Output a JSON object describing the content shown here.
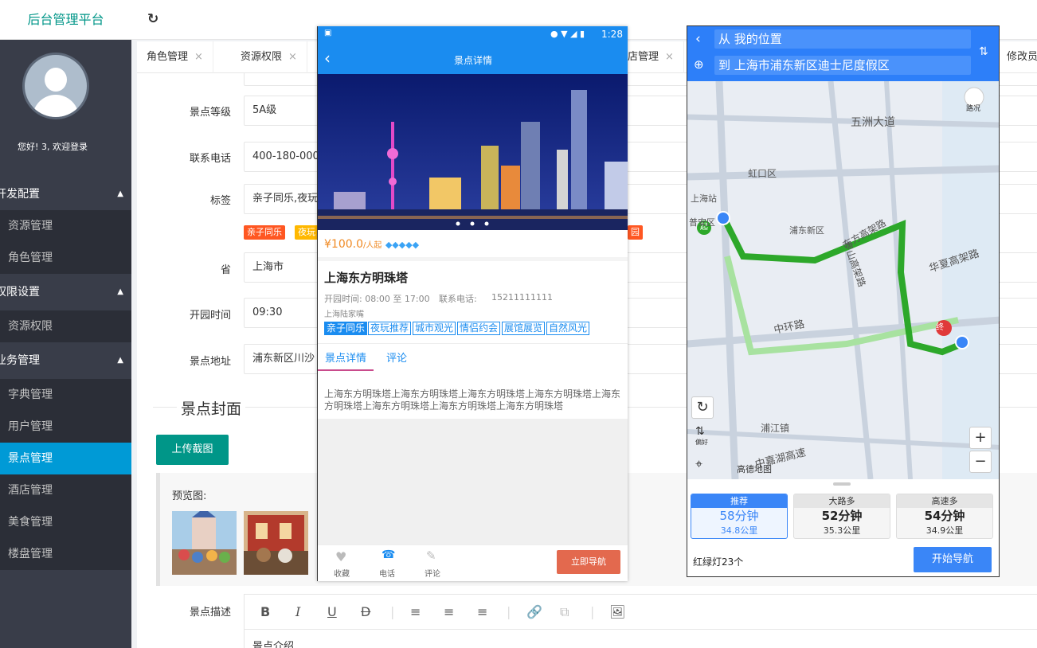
{
  "app": {
    "title": "后台管理平台",
    "refresh_icon": "refresh-icon"
  },
  "sidebar": {
    "welcome": "您好! 3, 欢迎登录",
    "groups": [
      {
        "label": "开发配置",
        "items": [
          "资源管理",
          "角色管理"
        ]
      },
      {
        "label": "权限设置",
        "items": [
          "资源权限"
        ]
      },
      {
        "label": "业务管理",
        "items": [
          "字典管理",
          "用户管理",
          "景点管理",
          "酒店管理",
          "美食管理",
          "楼盘管理"
        ]
      }
    ],
    "active_item": "景点管理",
    "active_color": "#009ad6"
  },
  "tabs": [
    {
      "label": "角色管理",
      "close": "×"
    },
    {
      "label": "资源权限",
      "close": "×"
    },
    {
      "label": "店管理",
      "close": "×"
    },
    {
      "label": "修改员工",
      "close": ""
    }
  ],
  "form": {
    "fields": [
      {
        "label": "景点等级",
        "value": "5A级"
      },
      {
        "label": "联系电话",
        "value": "400-180-000"
      },
      {
        "label": "标签",
        "value": "亲子同乐,夜玩"
      },
      {
        "label": "省",
        "value": "上海市"
      },
      {
        "label": "开园时间",
        "value": "09:30"
      },
      {
        "label": "景点地址",
        "value": "浦东新区川沙"
      }
    ],
    "tag_chips": [
      "亲子同乐",
      "夜玩",
      "园"
    ],
    "cover_legend": "景点封面",
    "upload_label": "上传截图",
    "preview_label": "预览图:",
    "desc_label": "景点描述",
    "desc_text": "景点介绍",
    "editor_tools": [
      "B",
      "I",
      "U",
      "D",
      "align-left-icon",
      "align-center-icon",
      "align-right-icon",
      "link-icon",
      "unlink-icon",
      "image-icon"
    ],
    "brand_color": "#009688"
  },
  "phone": {
    "status_time": "1:28",
    "nav_title": "景点详情",
    "price": "¥100.0",
    "price_unit": "/人起",
    "name": "上海东方明珠塔",
    "hours": "开园时间:  08:00 至 17:00",
    "phone_label": "联系电话:",
    "phone_value": "15211111111",
    "location": "上海陆家嘴",
    "tags": [
      "亲子同乐",
      "夜玩推荐",
      "城市观光",
      "情侣约会",
      "展馆展览",
      "自然风光"
    ],
    "tabs": [
      "景点详情",
      "评论"
    ],
    "description": "上海东方明珠塔上海东方明珠塔上海东方明珠塔上海东方明珠塔上海东方明珠塔上海东方明珠塔上海东方明珠塔上海东方明珠塔",
    "bottom_actions": [
      "收藏",
      "电话",
      "评论"
    ],
    "navigate_button": "立即导航",
    "accent": "#1a8cf0",
    "price_color": "#f08a24",
    "nav_btn_color": "#e3694e"
  },
  "map": {
    "from": "从 我的位置",
    "to": "到 上海市浦东新区迪士尼度假区",
    "traffic_label": "路况",
    "prefer_label": "偏好",
    "map_labels": [
      "五洲大道",
      "虹口区",
      "上海站",
      "普安区",
      "浦东新区",
      "中环路",
      "华夏高架路",
      "浦江镇",
      "中嘉湖高速",
      "高德地图",
      "罗山高架路",
      "东方高架路"
    ],
    "routes": [
      {
        "tag": "推荐",
        "time": "58分钟",
        "dist": "34.8公里"
      },
      {
        "tag": "大路多",
        "time": "52分钟",
        "dist": "35.3公里"
      },
      {
        "tag": "高速多",
        "time": "54分钟",
        "dist": "34.9公里"
      }
    ],
    "lights": "红绿灯23个",
    "start_button": "开始导航",
    "start_marker": "起",
    "end_marker": "终",
    "accent": "#2d7ff9"
  }
}
